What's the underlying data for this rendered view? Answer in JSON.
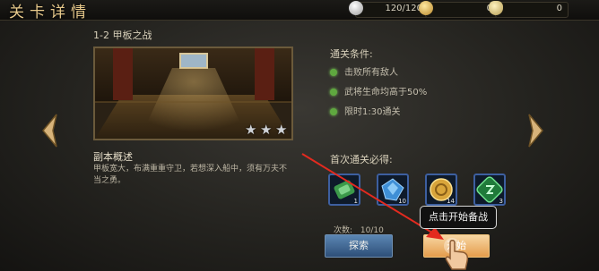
{
  "header": {
    "title": "关卡详情"
  },
  "resources": [
    {
      "name": "stamina",
      "value": "120/120",
      "color": "#c7c7c7"
    },
    {
      "name": "gold",
      "value": "0",
      "color": "#d9b24d"
    },
    {
      "name": "ingot",
      "value": "0",
      "color": "#d6c07a"
    }
  ],
  "stage": {
    "name": "1-2 甲板之战",
    "stars": 3,
    "overview_title": "副本概述",
    "overview_text": "甲板宽大，布满重重守卫，若想深入船中，须有万夫不当之勇。"
  },
  "conditions": {
    "title": "通关条件:",
    "items": [
      "击败所有敌人",
      "武将生命均高于50%",
      "限时1:30通关"
    ],
    "status_color": "#5fa83f"
  },
  "rewards": {
    "title": "首次通关必得:",
    "items": [
      {
        "icon": "green-scroll-icon",
        "count": "1"
      },
      {
        "icon": "blue-gem-icon",
        "count": "10"
      },
      {
        "icon": "gold-coin-icon",
        "count": "14"
      },
      {
        "icon": "green-token-icon",
        "count": "3"
      }
    ]
  },
  "actions": {
    "attempts_label": "次数:",
    "attempts_value": "10/10",
    "explore_label": "探索",
    "start_label": "开始",
    "tooltip": "点击开始备战"
  }
}
